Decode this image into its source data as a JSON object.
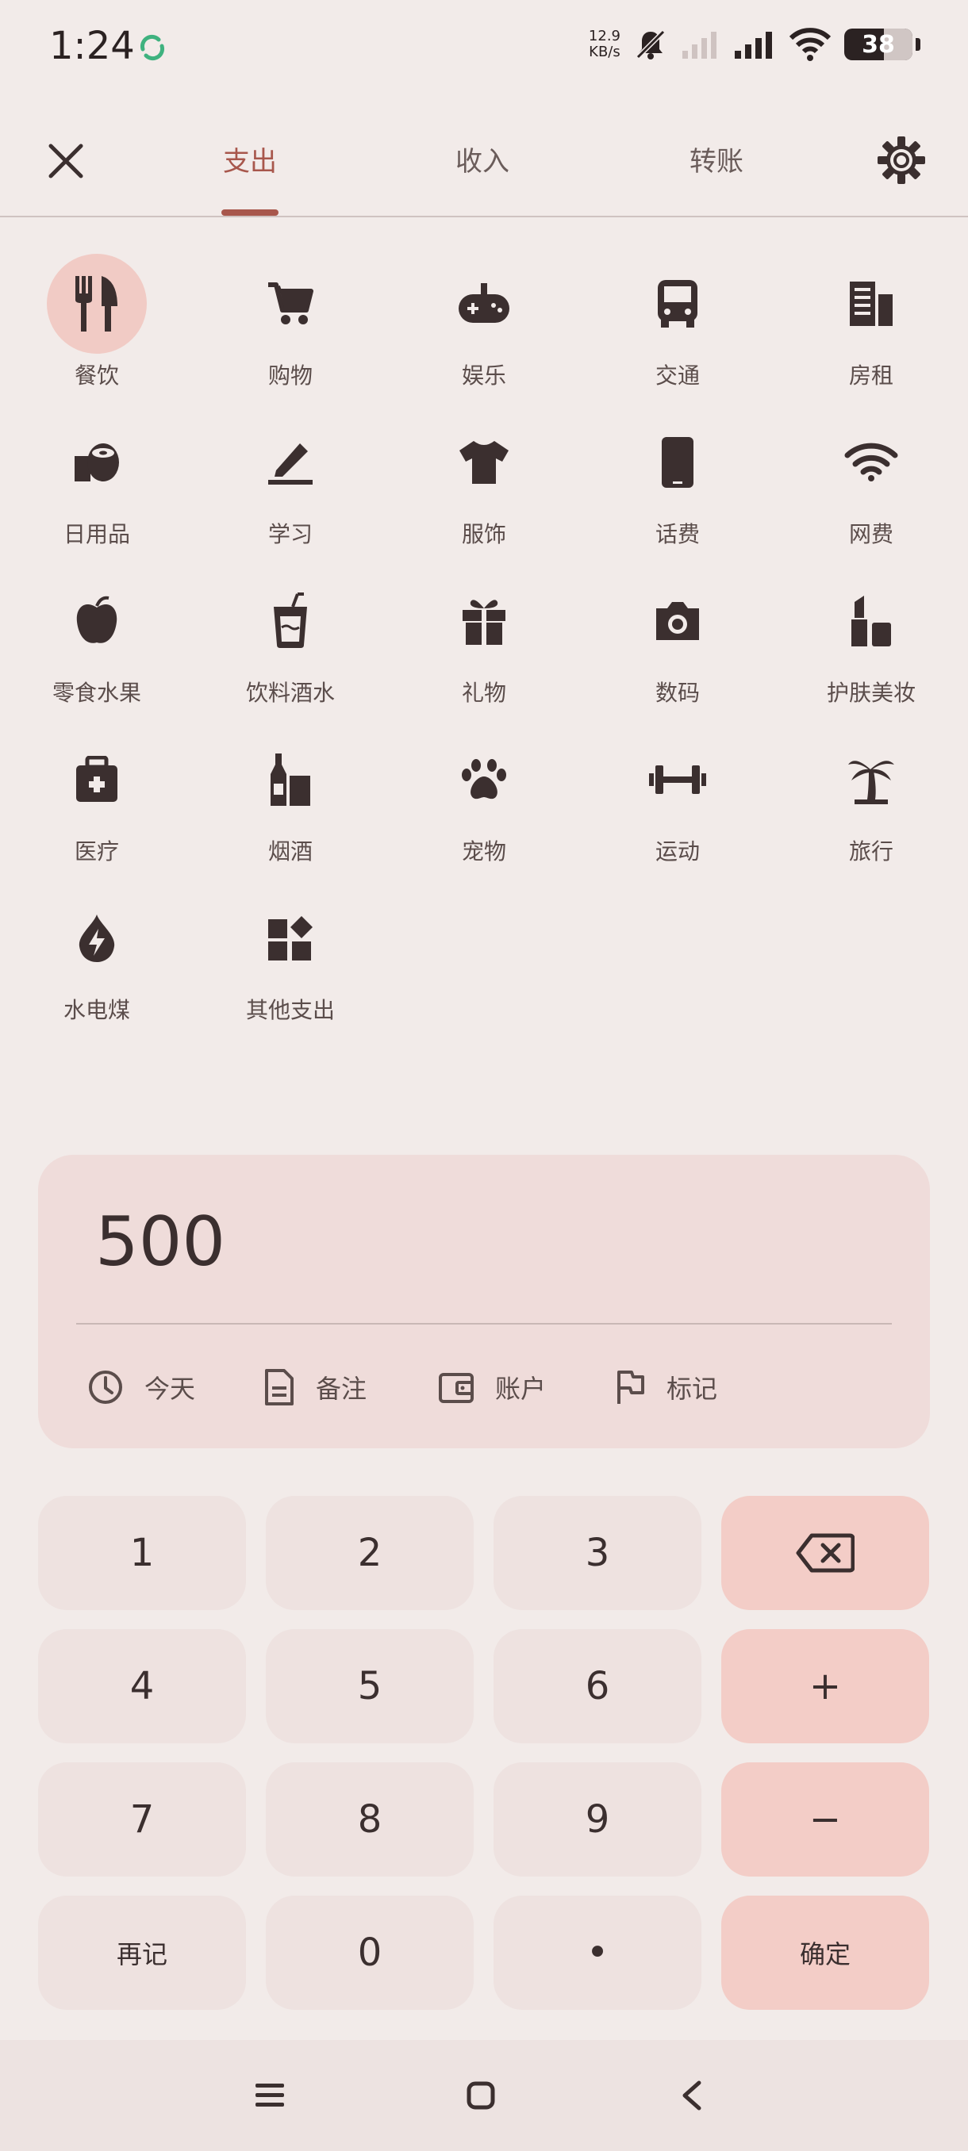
{
  "status": {
    "time": "1:24",
    "net_speed": "12.9",
    "net_unit": "KB/s",
    "battery": "38"
  },
  "tabs": [
    {
      "label": "支出"
    },
    {
      "label": "收入"
    },
    {
      "label": "转账"
    }
  ],
  "categories": [
    {
      "label": "餐饮",
      "icon": "fork-knife-icon"
    },
    {
      "label": "购物",
      "icon": "cart-icon"
    },
    {
      "label": "娱乐",
      "icon": "gamepad-icon"
    },
    {
      "label": "交通",
      "icon": "bus-icon"
    },
    {
      "label": "房租",
      "icon": "building-icon"
    },
    {
      "label": "日用品",
      "icon": "tissue-roll-icon"
    },
    {
      "label": "学习",
      "icon": "pen-icon"
    },
    {
      "label": "服饰",
      "icon": "tshirt-icon"
    },
    {
      "label": "话费",
      "icon": "phone-icon"
    },
    {
      "label": "网费",
      "icon": "wifi-icon"
    },
    {
      "label": "零食水果",
      "icon": "apple-icon"
    },
    {
      "label": "饮料酒水",
      "icon": "drink-cup-icon"
    },
    {
      "label": "礼物",
      "icon": "gift-icon"
    },
    {
      "label": "数码",
      "icon": "camera-icon"
    },
    {
      "label": "护肤美妆",
      "icon": "lipstick-icon"
    },
    {
      "label": "医疗",
      "icon": "medical-kit-icon"
    },
    {
      "label": "烟酒",
      "icon": "bottle-icon"
    },
    {
      "label": "宠物",
      "icon": "paw-icon"
    },
    {
      "label": "运动",
      "icon": "dumbbell-icon"
    },
    {
      "label": "旅行",
      "icon": "palm-tree-icon"
    },
    {
      "label": "水电煤",
      "icon": "utility-drop-icon"
    },
    {
      "label": "其他支出",
      "icon": "widgets-icon"
    }
  ],
  "entry": {
    "amount": "500",
    "options": [
      {
        "label": "今天",
        "icon": "clock-icon"
      },
      {
        "label": "备注",
        "icon": "note-icon"
      },
      {
        "label": "账户",
        "icon": "wallet-icon"
      },
      {
        "label": "标记",
        "icon": "flag-icon"
      }
    ]
  },
  "keypad": {
    "k1": "1",
    "k2": "2",
    "k3": "3",
    "k4": "4",
    "k5": "5",
    "k6": "6",
    "k7": "7",
    "k8": "8",
    "k9": "9",
    "again": "再记",
    "k0": "0",
    "dot": "•",
    "plus": "+",
    "minus": "−",
    "confirm": "确定"
  },
  "colors": {
    "accent": "#a8574c",
    "selected_bg": "#f1cbc5",
    "panel_bg": "#efdcda",
    "key_accent": "#f3cdc7"
  }
}
